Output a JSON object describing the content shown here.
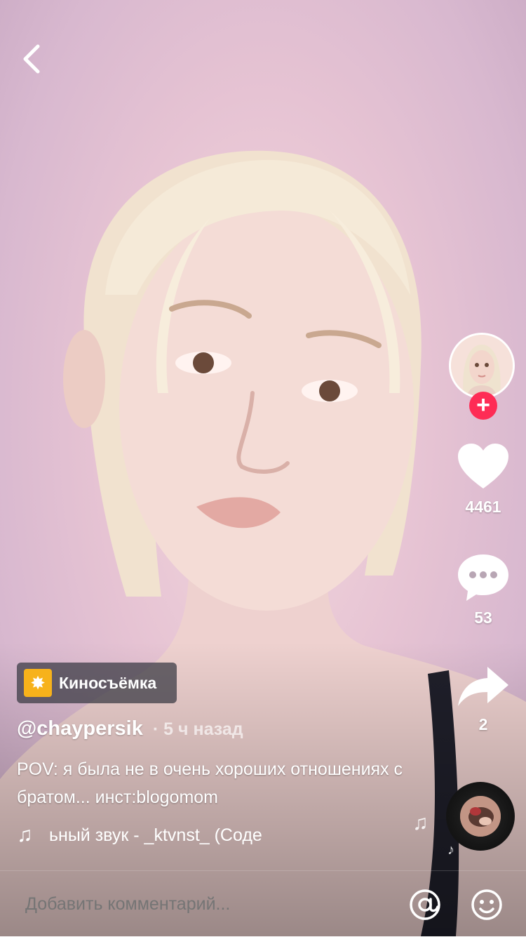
{
  "effect": {
    "label": "Киносъёмка",
    "icon": "sparkle-effect-icon"
  },
  "author": {
    "username": "@chaypersik",
    "time": "· 5 ч назад"
  },
  "caption": {
    "text": "POV: я была не в очень хороших отношениях с братом... инст:blogomom"
  },
  "music": {
    "text": "ьный звук - _ktvnst_ (Соде"
  },
  "actions": {
    "likes": "4461",
    "comments": "53",
    "shares": "2"
  },
  "comment": {
    "placeholder": "Добавить комментарий..."
  },
  "colors": {
    "accent": "#fe2c55",
    "effect_icon": "#f7b21b"
  }
}
